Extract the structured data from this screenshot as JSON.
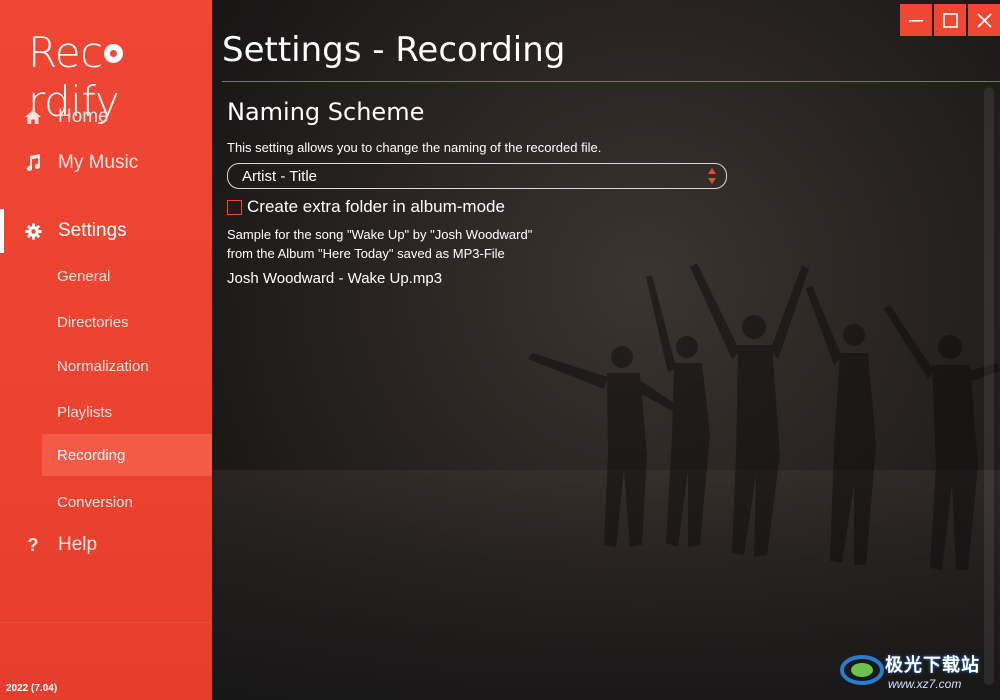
{
  "app": {
    "logo_before": "Rec",
    "logo_after": "rdify",
    "version": "2022 (7.04)"
  },
  "sidebar": {
    "main_items": [
      {
        "label": "Home",
        "icon": "home-icon"
      },
      {
        "label": "My Music",
        "icon": "music-note-icon"
      },
      {
        "label": "Settings",
        "icon": "gear-icon",
        "active": true
      },
      {
        "label": "Help",
        "icon": "question-icon"
      }
    ],
    "settings_items": [
      {
        "label": "General"
      },
      {
        "label": "Directories"
      },
      {
        "label": "Normalization"
      },
      {
        "label": "Playlists"
      },
      {
        "label": "Recording",
        "active": true
      },
      {
        "label": "Conversion"
      }
    ]
  },
  "window_controls": {
    "minimize_icon": "minimize-icon",
    "maximize_icon": "maximize-icon",
    "close_icon": "close-icon"
  },
  "page": {
    "title": "Settings - Recording",
    "section_title": "Naming Scheme",
    "description": "This setting allows you to change the naming of the recorded file.",
    "naming_select": {
      "value": "Artist - Title"
    },
    "album_folder_checkbox": {
      "label": "Create extra folder in album-mode",
      "checked": false
    },
    "sample_line1": "Sample for the song \"Wake Up\" by \"Josh Woodward\"",
    "sample_line2": "from the Album \"Here Today\" saved as MP3-File",
    "result_filename": "Josh Woodward - Wake Up.mp3"
  },
  "watermark": {
    "text": "极光下载站",
    "url": "www.xz7.com"
  },
  "colors": {
    "accent": "#ef4733",
    "sidebar_active_sub": "#f35a47",
    "text": "#ffffff"
  }
}
